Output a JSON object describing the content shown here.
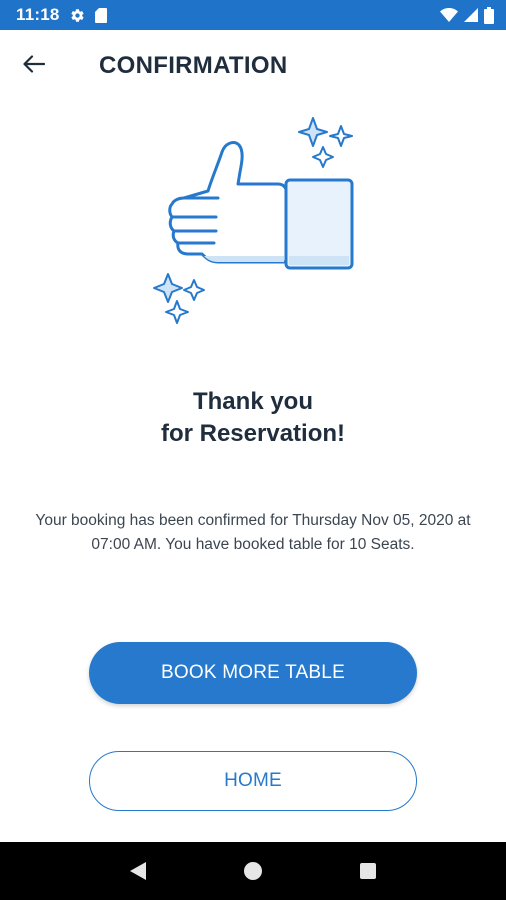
{
  "status_bar": {
    "time": "11:18",
    "background_color": "#1f73c8",
    "left_icons": [
      "settings-gear-icon",
      "sd-card-icon"
    ],
    "right_icons": [
      "wifi-icon",
      "cellular-signal-icon",
      "battery-icon"
    ]
  },
  "header": {
    "back_icon": "arrow-left-icon",
    "title": "CONFIRMATION"
  },
  "illustration": {
    "icon": "thumbs-up-with-sparkles-icon",
    "accent_color": "#2679cc"
  },
  "message": {
    "title_line1": "Thank you",
    "title_line2": "for Reservation!",
    "body": "Your booking has been confirmed for Thursday Nov 05, 2020 at 07:00 AM. You have booked table for 10 Seats."
  },
  "actions": {
    "primary_label": "BOOK MORE TABLE",
    "secondary_label": "HOME",
    "accent_color": "#2679cc"
  },
  "nav_bar": {
    "icons": [
      "back-triangle-icon",
      "home-circle-icon",
      "recents-square-icon"
    ]
  }
}
